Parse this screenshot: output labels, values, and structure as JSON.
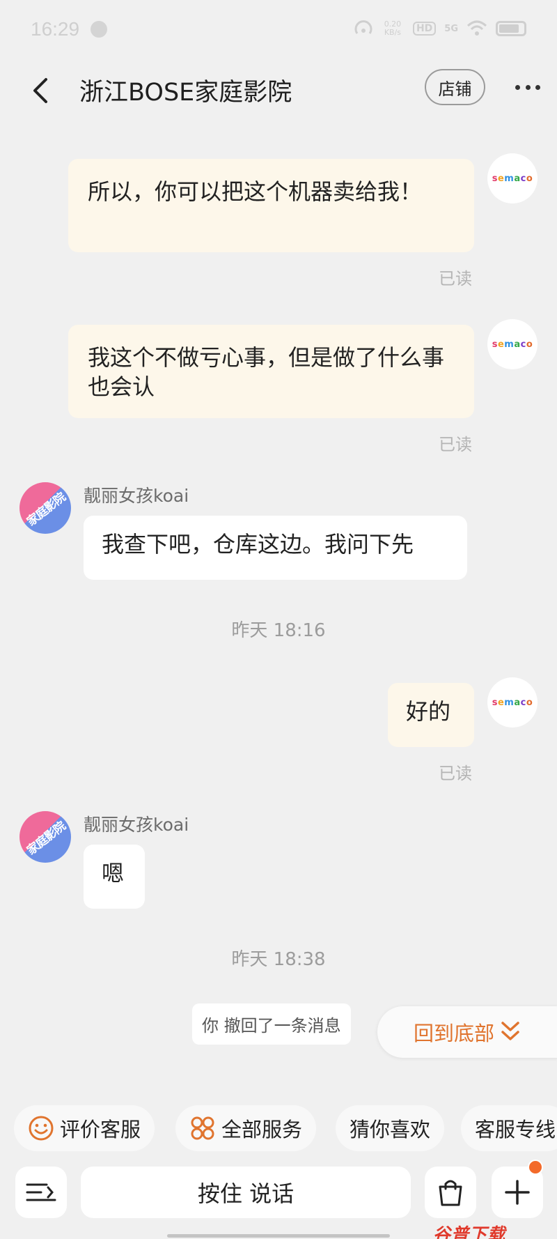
{
  "status_bar": {
    "time": "16:29",
    "net_speed_value": "0.20",
    "net_speed_unit": "KB/s",
    "hd_label": "HD",
    "signal_label": "5G"
  },
  "header": {
    "title": "浙江BOSE家庭影院",
    "store_button": "店铺"
  },
  "avatars": {
    "self_logo_text": "semaco",
    "shop_avatar_text": "家庭影院"
  },
  "messages": {
    "m1_text": "所以，你可以把这个机器卖给我！",
    "m1_status": "已读",
    "m2_text": "我这个不做亏心事，但是做了什么事也会认",
    "m2_status": "已读",
    "m3_sender": "靓丽女孩koai",
    "m3_text": "我查下吧，仓库这边。我问下先",
    "time1": "昨天  18:16",
    "m4_text": "好的",
    "m4_status": "已读",
    "m5_sender": "靓丽女孩koai",
    "m5_text": "嗯",
    "time2": "昨天  18:38",
    "recall_text": "你 撤回了一条消息"
  },
  "back_to_bottom": "回到底部",
  "services": [
    {
      "label": "评价客服",
      "icon": "smile-icon"
    },
    {
      "label": "全部服务",
      "icon": "grid-icon"
    },
    {
      "label": "猜你喜欢",
      "icon": ""
    },
    {
      "label": "客服专线",
      "icon": ""
    }
  ],
  "input": {
    "hold_to_talk": "按住 说话"
  },
  "watermark": "谷普下载",
  "colors": {
    "accent": "#e0742e",
    "self_bubble": "#fdf7ea",
    "other_bubble": "#ffffff",
    "background": "#f0f0f0",
    "badge": "#f36a2a"
  }
}
